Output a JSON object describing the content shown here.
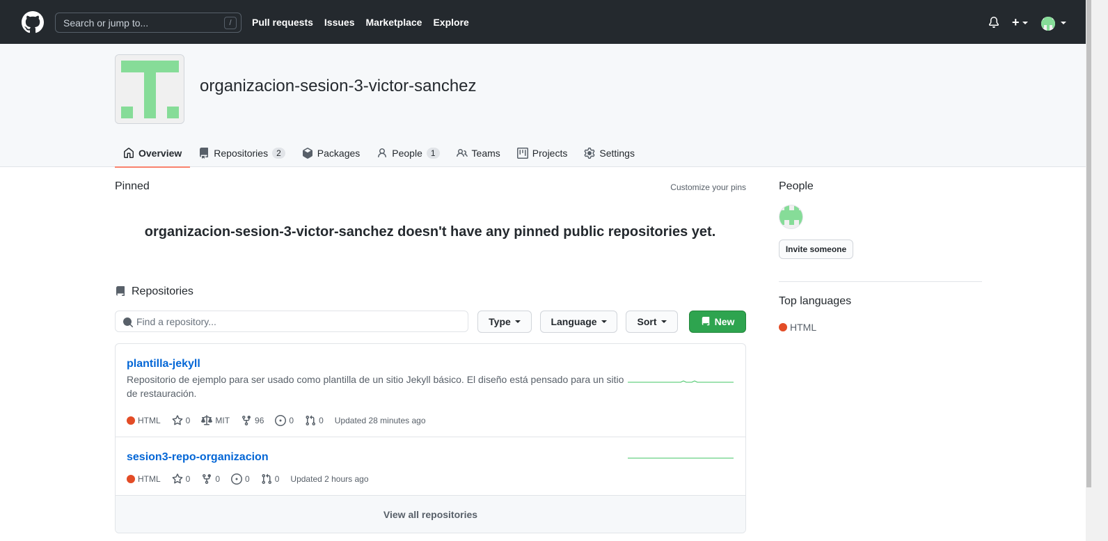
{
  "header": {
    "search_placeholder": "Search or jump to...",
    "search_shortcut": "/",
    "nav": [
      "Pull requests",
      "Issues",
      "Marketplace",
      "Explore"
    ]
  },
  "org": {
    "name": "organizacion-sesion-3-victor-sanchez"
  },
  "tabs": [
    {
      "label": "Overview",
      "icon": "home-icon",
      "selected": true
    },
    {
      "label": "Repositories",
      "icon": "repo-icon",
      "count": "2"
    },
    {
      "label": "Packages",
      "icon": "package-icon"
    },
    {
      "label": "People",
      "icon": "person-icon",
      "count": "1"
    },
    {
      "label": "Teams",
      "icon": "people-icon"
    },
    {
      "label": "Projects",
      "icon": "project-icon"
    },
    {
      "label": "Settings",
      "icon": "gear-icon"
    }
  ],
  "pinned": {
    "heading": "Pinned",
    "customize_label": "Customize your pins",
    "empty_message": "organizacion-sesion-3-victor-sanchez doesn't have any pinned public repositories yet."
  },
  "repositories": {
    "heading": "Repositories",
    "find_placeholder": "Find a repository...",
    "type_label": "Type",
    "language_label": "Language",
    "sort_label": "Sort",
    "new_label": "New",
    "view_all_label": "View all repositories",
    "items": [
      {
        "name": "plantilla-jekyll",
        "description": "Repositorio de ejemplo para ser usado como plantilla de un sitio Jekyll básico. El diseño está pensado para un sitio de restauración.",
        "language": "HTML",
        "stars": "0",
        "license": "MIT",
        "forks": "96",
        "issues": "0",
        "pulls": "0",
        "updated": "Updated 28 minutes ago"
      },
      {
        "name": "sesion3-repo-organizacion",
        "description": "",
        "language": "HTML",
        "stars": "0",
        "forks": "0",
        "issues": "0",
        "pulls": "0",
        "updated": "Updated 2 hours ago"
      }
    ]
  },
  "sidebar": {
    "people_heading": "People",
    "invite_label": "Invite someone",
    "top_languages_heading": "Top languages",
    "languages": [
      {
        "name": "HTML",
        "color": "#e34c26"
      }
    ]
  },
  "colors": {
    "header_bg": "#24292e",
    "link": "#0366d6",
    "new_button": "#2ea44f",
    "tab_underline": "#f9826c",
    "identicon": "#86dc98"
  }
}
